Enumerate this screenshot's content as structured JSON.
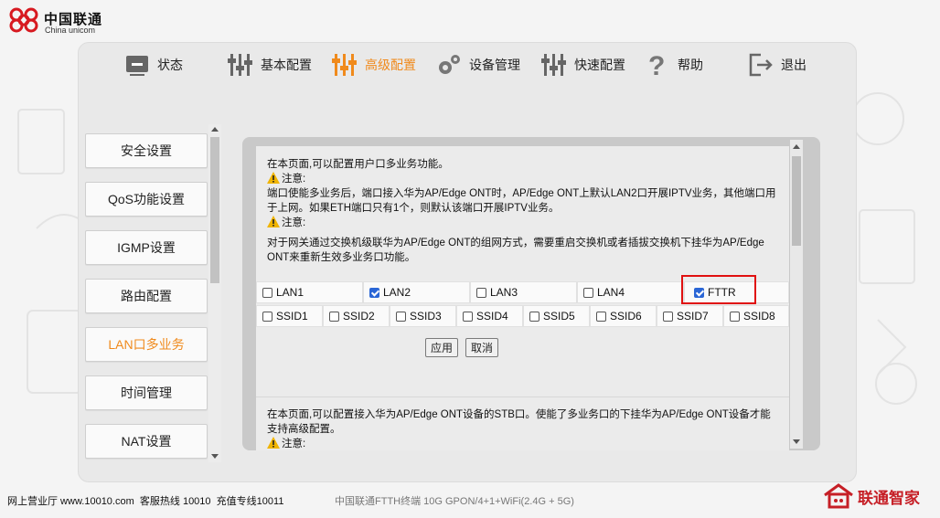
{
  "brand": {
    "cn": "中国联通",
    "en": "China unicom",
    "footer_logo": "联通智家"
  },
  "nav": [
    {
      "label": "状态",
      "icon": "monitor-icon"
    },
    {
      "label": "基本配置",
      "icon": "sliders-icon"
    },
    {
      "label": "高级配置",
      "icon": "sliders-icon",
      "active": true
    },
    {
      "label": "设备管理",
      "icon": "gears-icon"
    },
    {
      "label": "快速配置",
      "icon": "sliders-icon"
    },
    {
      "label": "帮助",
      "icon": "question-icon"
    },
    {
      "label": "退出",
      "icon": "logout-icon"
    }
  ],
  "sidebar": {
    "items": [
      {
        "label": "安全设置"
      },
      {
        "label": "QoS功能设置"
      },
      {
        "label": "IGMP设置"
      },
      {
        "label": "路由配置"
      },
      {
        "label": "LAN口多业务",
        "active": true
      },
      {
        "label": "时间管理"
      },
      {
        "label": "NAT设置"
      }
    ]
  },
  "content": {
    "intro": "在本页面,可以配置用户口多业务功能。",
    "note_label": "注意:",
    "note1": "端口使能多业务后，端口接入华为AP/Edge ONT时，AP/Edge ONT上默认LAN2口开展IPTV业务，其他端口用于上网。如果ETH端口只有1个，则默认该端口开展IPTV业务。",
    "note_label2": "注意:",
    "note2": "对于网关通过交换机级联华为AP/Edge ONT的组网方式，需要重启交换机或者插拔交换机下挂华为AP/Edge ONT来重新生效多业务口功能。",
    "ports": [
      {
        "label": "LAN1",
        "checked": false
      },
      {
        "label": "LAN2",
        "checked": true
      },
      {
        "label": "LAN3",
        "checked": false
      },
      {
        "label": "LAN4",
        "checked": false
      },
      {
        "label": "FTTR",
        "checked": true
      }
    ],
    "ssids": [
      {
        "label": "SSID1"
      },
      {
        "label": "SSID2"
      },
      {
        "label": "SSID3"
      },
      {
        "label": "SSID4"
      },
      {
        "label": "SSID5"
      },
      {
        "label": "SSID6"
      },
      {
        "label": "SSID7"
      },
      {
        "label": "SSID8"
      }
    ],
    "apply_label": "应用",
    "cancel_label": "取消",
    "stb_intro": "在本页面,可以配置接入华为AP/Edge ONT设备的STB口。使能了多业务口的下挂华为AP/Edge ONT设备才能支持高级配置。",
    "note_label3": "注意:"
  },
  "footer": {
    "hall": "网上营业厅 www.10010.com",
    "hotline": "客服热线  10010",
    "recharge": "充值专线10011",
    "model": "中国联通FTTH终端 10G GPON/4+1+WiFi(2.4G + 5G)"
  },
  "colors": {
    "accent": "#f08a1c",
    "highlight": "#e01010",
    "brand_red": "#c61f26",
    "checkbox": "#2a66d6"
  }
}
